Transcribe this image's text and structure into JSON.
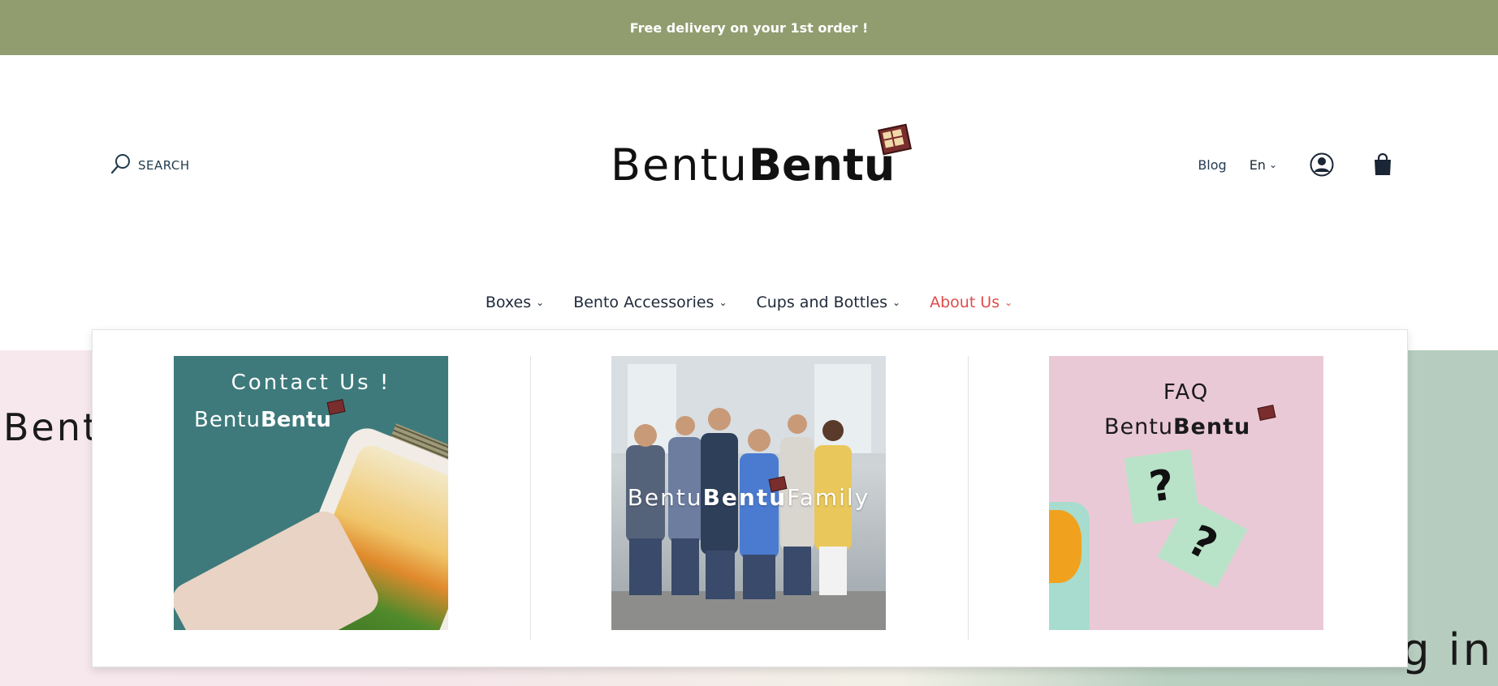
{
  "announcement": {
    "text": "Free delivery on your 1st order !"
  },
  "header": {
    "search_label": "SEARCH",
    "logo": {
      "light": "Bentu",
      "bold": "Bentu"
    },
    "blog_label": "Blog",
    "language": "En"
  },
  "nav": {
    "items": [
      {
        "label": "Boxes"
      },
      {
        "label": "Bento Accessories"
      },
      {
        "label": "Cups and Bottles"
      },
      {
        "label": "About Us"
      }
    ]
  },
  "mega_menu": {
    "cards": [
      {
        "title": "Contact  Us !",
        "brand_light": "Bentu",
        "brand_bold": "Bentu"
      },
      {
        "brand_light": "Bentu",
        "brand_bold": "Bentu",
        "brand_suffix": "Family"
      },
      {
        "title": "FAQ",
        "brand_light": "Bentu",
        "brand_bold": "Bentu",
        "note1": "?",
        "note2": "?"
      }
    ]
  },
  "hero": {
    "left_text": "Bent",
    "right_text": "g in"
  },
  "colors": {
    "announcement_bg": "#919d6f",
    "active_nav": "#e04b4b",
    "text": "#1f2a3a"
  }
}
